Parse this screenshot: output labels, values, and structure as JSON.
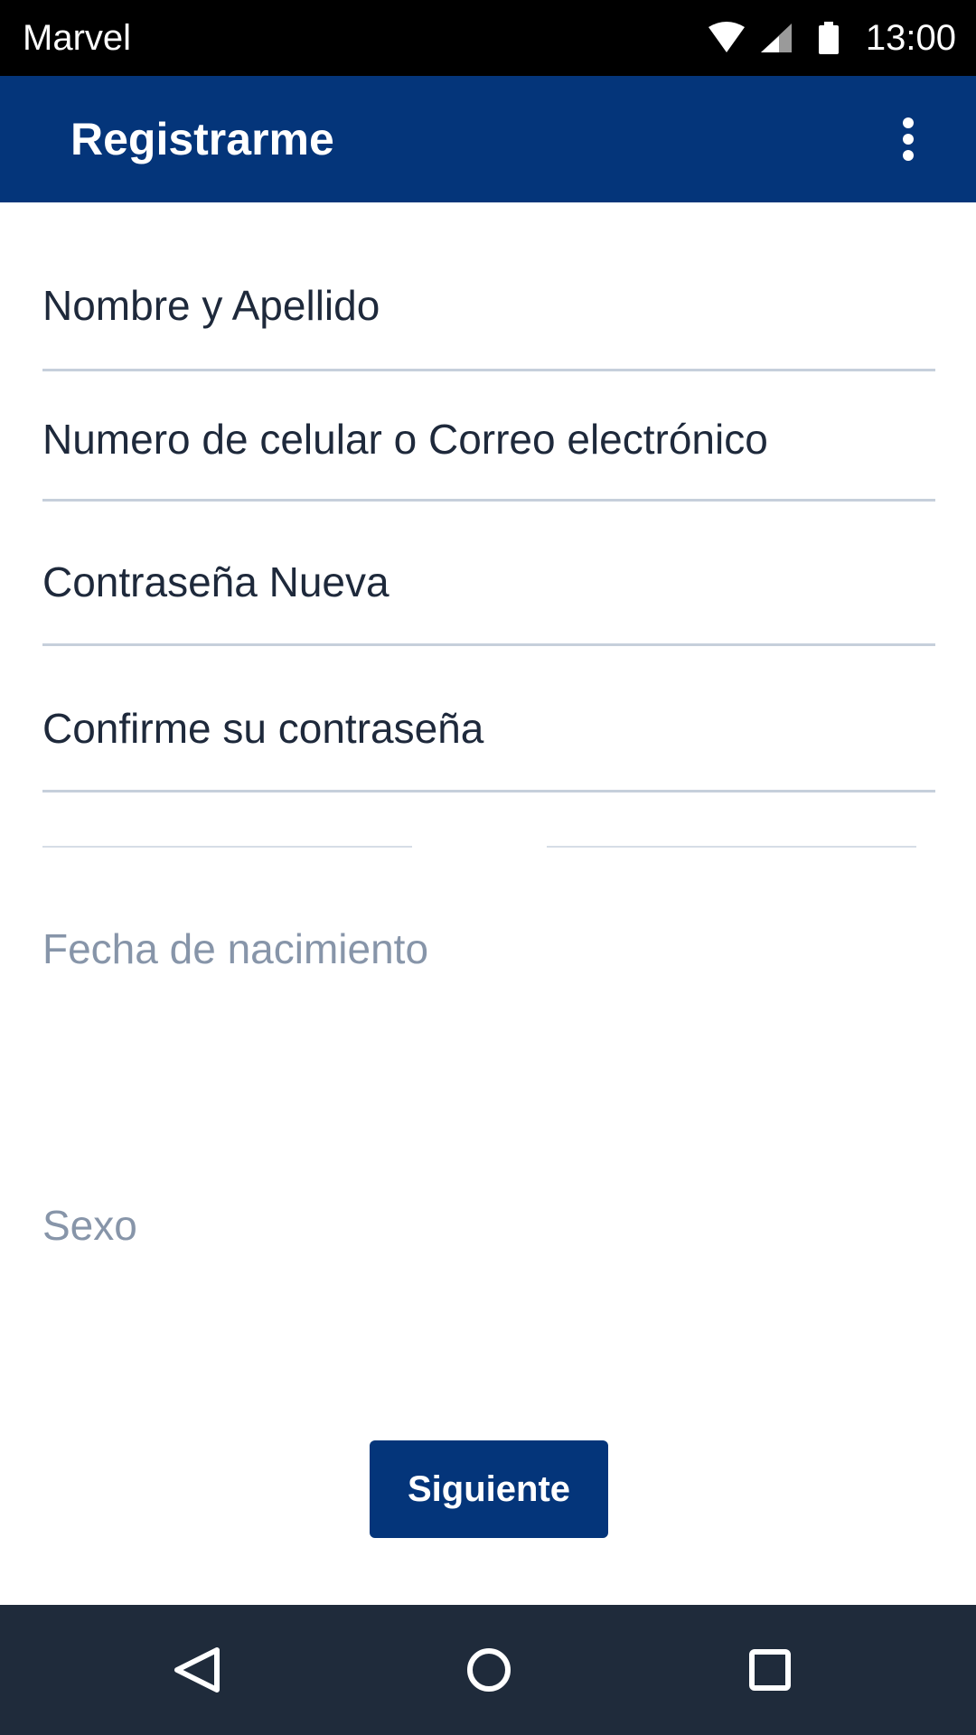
{
  "status_bar": {
    "carrier": "Marvel",
    "time": "13:00",
    "icons": [
      "wifi-icon",
      "signal-icon",
      "battery-icon"
    ]
  },
  "app_bar": {
    "title": "Registrarme",
    "menu_icon": "more-vert-icon"
  },
  "form": {
    "fields": [
      {
        "label": "Nombre y Apellido"
      },
      {
        "label": "Numero de celular o Correo electrónico"
      },
      {
        "label": "Contraseña Nueva"
      },
      {
        "label": "Confirme su contraseña"
      }
    ],
    "birthdate_label": "Fecha de nacimiento",
    "sex_label": "Sexo"
  },
  "actions": {
    "next_label": "Siguiente"
  },
  "nav_bar": {
    "icons": [
      "back-icon",
      "home-icon",
      "recents-icon"
    ]
  },
  "colors": {
    "primary": "#04357a",
    "status_bar": "#000000",
    "nav_bar": "#1f2b3b",
    "text": "#1e293b",
    "hint": "#8795a9",
    "divider": "#c6cfdb"
  }
}
